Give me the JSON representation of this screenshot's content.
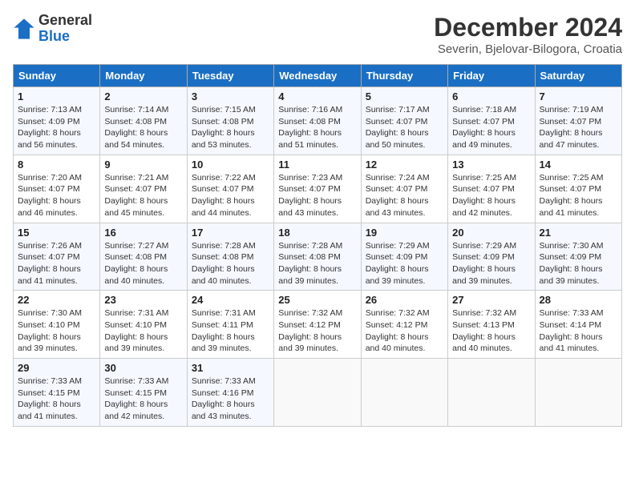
{
  "header": {
    "logo_general": "General",
    "logo_blue": "Blue",
    "month_title": "December 2024",
    "location": "Severin, Bjelovar-Bilogora, Croatia"
  },
  "weekdays": [
    "Sunday",
    "Monday",
    "Tuesday",
    "Wednesday",
    "Thursday",
    "Friday",
    "Saturday"
  ],
  "weeks": [
    [
      {
        "day": "1",
        "sunrise": "Sunrise: 7:13 AM",
        "sunset": "Sunset: 4:09 PM",
        "daylight": "Daylight: 8 hours and 56 minutes."
      },
      {
        "day": "2",
        "sunrise": "Sunrise: 7:14 AM",
        "sunset": "Sunset: 4:08 PM",
        "daylight": "Daylight: 8 hours and 54 minutes."
      },
      {
        "day": "3",
        "sunrise": "Sunrise: 7:15 AM",
        "sunset": "Sunset: 4:08 PM",
        "daylight": "Daylight: 8 hours and 53 minutes."
      },
      {
        "day": "4",
        "sunrise": "Sunrise: 7:16 AM",
        "sunset": "Sunset: 4:08 PM",
        "daylight": "Daylight: 8 hours and 51 minutes."
      },
      {
        "day": "5",
        "sunrise": "Sunrise: 7:17 AM",
        "sunset": "Sunset: 4:07 PM",
        "daylight": "Daylight: 8 hours and 50 minutes."
      },
      {
        "day": "6",
        "sunrise": "Sunrise: 7:18 AM",
        "sunset": "Sunset: 4:07 PM",
        "daylight": "Daylight: 8 hours and 49 minutes."
      },
      {
        "day": "7",
        "sunrise": "Sunrise: 7:19 AM",
        "sunset": "Sunset: 4:07 PM",
        "daylight": "Daylight: 8 hours and 47 minutes."
      }
    ],
    [
      {
        "day": "8",
        "sunrise": "Sunrise: 7:20 AM",
        "sunset": "Sunset: 4:07 PM",
        "daylight": "Daylight: 8 hours and 46 minutes."
      },
      {
        "day": "9",
        "sunrise": "Sunrise: 7:21 AM",
        "sunset": "Sunset: 4:07 PM",
        "daylight": "Daylight: 8 hours and 45 minutes."
      },
      {
        "day": "10",
        "sunrise": "Sunrise: 7:22 AM",
        "sunset": "Sunset: 4:07 PM",
        "daylight": "Daylight: 8 hours and 44 minutes."
      },
      {
        "day": "11",
        "sunrise": "Sunrise: 7:23 AM",
        "sunset": "Sunset: 4:07 PM",
        "daylight": "Daylight: 8 hours and 43 minutes."
      },
      {
        "day": "12",
        "sunrise": "Sunrise: 7:24 AM",
        "sunset": "Sunset: 4:07 PM",
        "daylight": "Daylight: 8 hours and 43 minutes."
      },
      {
        "day": "13",
        "sunrise": "Sunrise: 7:25 AM",
        "sunset": "Sunset: 4:07 PM",
        "daylight": "Daylight: 8 hours and 42 minutes."
      },
      {
        "day": "14",
        "sunrise": "Sunrise: 7:25 AM",
        "sunset": "Sunset: 4:07 PM",
        "daylight": "Daylight: 8 hours and 41 minutes."
      }
    ],
    [
      {
        "day": "15",
        "sunrise": "Sunrise: 7:26 AM",
        "sunset": "Sunset: 4:07 PM",
        "daylight": "Daylight: 8 hours and 41 minutes."
      },
      {
        "day": "16",
        "sunrise": "Sunrise: 7:27 AM",
        "sunset": "Sunset: 4:08 PM",
        "daylight": "Daylight: 8 hours and 40 minutes."
      },
      {
        "day": "17",
        "sunrise": "Sunrise: 7:28 AM",
        "sunset": "Sunset: 4:08 PM",
        "daylight": "Daylight: 8 hours and 40 minutes."
      },
      {
        "day": "18",
        "sunrise": "Sunrise: 7:28 AM",
        "sunset": "Sunset: 4:08 PM",
        "daylight": "Daylight: 8 hours and 39 minutes."
      },
      {
        "day": "19",
        "sunrise": "Sunrise: 7:29 AM",
        "sunset": "Sunset: 4:09 PM",
        "daylight": "Daylight: 8 hours and 39 minutes."
      },
      {
        "day": "20",
        "sunrise": "Sunrise: 7:29 AM",
        "sunset": "Sunset: 4:09 PM",
        "daylight": "Daylight: 8 hours and 39 minutes."
      },
      {
        "day": "21",
        "sunrise": "Sunrise: 7:30 AM",
        "sunset": "Sunset: 4:09 PM",
        "daylight": "Daylight: 8 hours and 39 minutes."
      }
    ],
    [
      {
        "day": "22",
        "sunrise": "Sunrise: 7:30 AM",
        "sunset": "Sunset: 4:10 PM",
        "daylight": "Daylight: 8 hours and 39 minutes."
      },
      {
        "day": "23",
        "sunrise": "Sunrise: 7:31 AM",
        "sunset": "Sunset: 4:10 PM",
        "daylight": "Daylight: 8 hours and 39 minutes."
      },
      {
        "day": "24",
        "sunrise": "Sunrise: 7:31 AM",
        "sunset": "Sunset: 4:11 PM",
        "daylight": "Daylight: 8 hours and 39 minutes."
      },
      {
        "day": "25",
        "sunrise": "Sunrise: 7:32 AM",
        "sunset": "Sunset: 4:12 PM",
        "daylight": "Daylight: 8 hours and 39 minutes."
      },
      {
        "day": "26",
        "sunrise": "Sunrise: 7:32 AM",
        "sunset": "Sunset: 4:12 PM",
        "daylight": "Daylight: 8 hours and 40 minutes."
      },
      {
        "day": "27",
        "sunrise": "Sunrise: 7:32 AM",
        "sunset": "Sunset: 4:13 PM",
        "daylight": "Daylight: 8 hours and 40 minutes."
      },
      {
        "day": "28",
        "sunrise": "Sunrise: 7:33 AM",
        "sunset": "Sunset: 4:14 PM",
        "daylight": "Daylight: 8 hours and 41 minutes."
      }
    ],
    [
      {
        "day": "29",
        "sunrise": "Sunrise: 7:33 AM",
        "sunset": "Sunset: 4:15 PM",
        "daylight": "Daylight: 8 hours and 41 minutes."
      },
      {
        "day": "30",
        "sunrise": "Sunrise: 7:33 AM",
        "sunset": "Sunset: 4:15 PM",
        "daylight": "Daylight: 8 hours and 42 minutes."
      },
      {
        "day": "31",
        "sunrise": "Sunrise: 7:33 AM",
        "sunset": "Sunset: 4:16 PM",
        "daylight": "Daylight: 8 hours and 43 minutes."
      },
      null,
      null,
      null,
      null
    ]
  ]
}
